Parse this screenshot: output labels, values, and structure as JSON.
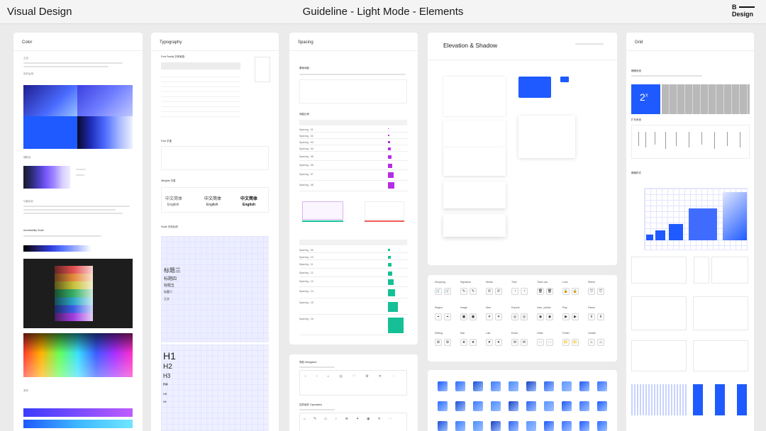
{
  "header": {
    "left_title": "Visual Design",
    "center_title": "Guideline - Light Mode - Elements",
    "logo_line1": "B",
    "logo_line2": "Design"
  },
  "cards": {
    "color": {
      "title": "Color",
      "section_labels": [
        "主色",
        "色彩运用",
        "辅助色",
        "功能色彩",
        "Accessibility Scale",
        "渐变"
      ]
    },
    "typography": {
      "title": "Typography",
      "section_labels": [
        "Font Family 字体家族",
        "Font 字重",
        "Weights 字重",
        "Scale 字体比例"
      ],
      "weights_samples": [
        "中文简体",
        "中文简体",
        "中文简体"
      ],
      "weights_english": [
        "English",
        "English",
        "English"
      ],
      "scale_headings": [
        "标题三",
        "标题四",
        "标题五",
        "标题六",
        "正文"
      ],
      "h_scale": [
        "H1",
        "H2",
        "H3",
        "H4",
        "H5",
        "H6"
      ]
    },
    "spacing": {
      "title": "Spacing",
      "section_labels": [
        "基础间距",
        "间距比例"
      ],
      "rows_a": [
        "Spacing - 01",
        "Spacing - 02",
        "Spacing - 03",
        "Spacing - 04",
        "Spacing - 05",
        "Spacing - 06",
        "Spacing - 07",
        "Spacing - 08"
      ],
      "rows_b": [
        "Spacing - 09",
        "Spacing - 10",
        "Spacing - 11",
        "Spacing - 12",
        "Spacing - 13",
        "Spacing - 14",
        "Spacing - 15",
        "Spacing - 16"
      ]
    },
    "navigation": {
      "title": "导航 Navigation",
      "section_labels": [
        "导航 Navigation",
        "控件组件 Operations"
      ]
    },
    "elevation": {
      "title": "Elevation & Shadow"
    },
    "icons_outline": {
      "labels": [
        "Shopping",
        "Signature",
        "Media",
        "Time",
        "Trash can",
        "Lock",
        "Shield",
        "Region",
        "Image",
        "Idea",
        "Explore",
        "User_outline",
        "Play",
        "Pause",
        "Setting",
        "Star",
        "Like",
        "Email",
        "Other",
        "Folder",
        "Candle"
      ],
      "glyphs": [
        "🛒",
        "✎",
        "✆",
        "◔",
        "🗑",
        "🔒",
        "⛉",
        "⌖",
        "▣",
        "✦",
        "◎",
        "◉",
        "▶",
        "Ⅱ",
        "⚙",
        "★",
        "♥",
        "✉",
        "⋯",
        "📁",
        "♨"
      ]
    },
    "grid": {
      "title": "Grid",
      "section_labels": [
        "栅格系统",
        "扩充系统",
        "栅格样式"
      ],
      "big_label": "2",
      "big_sup": "X"
    }
  },
  "colors": {
    "accent_blue": "#1e5aff",
    "purple": "#b62de4",
    "green": "#16c096",
    "bg": "#ebebeb"
  }
}
